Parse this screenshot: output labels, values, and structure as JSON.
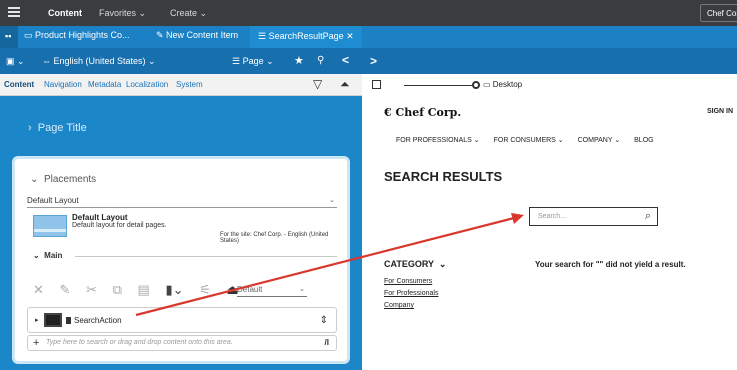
{
  "topbar": {
    "app_menu_icon": "hamburger-icon",
    "content_label": "Content",
    "favorites_label": "Favorites ⌄",
    "create_label": "Create ⌄",
    "user_label": "Chef Corp"
  },
  "tabs": [
    {
      "icon": "page-icon",
      "label": "Product Highlights Co..."
    },
    {
      "icon": "pencil-icon",
      "label": "New Content Item"
    },
    {
      "icon": "list-icon",
      "label": "SearchResultPage ✕"
    }
  ],
  "toolbar": {
    "site_label": "English (United States) ⌄",
    "page_label": "Page ⌄",
    "star_icon": "star-icon",
    "pin_icon": "pin-icon",
    "collapse_icon": "chevron-left-icon",
    "expand_icon": "chevron-right-icon"
  },
  "subtabs": [
    "Content",
    "Navigation",
    "Metadata",
    "Localization",
    "System"
  ],
  "left": {
    "page_title": "Page Title",
    "placements_label": "Placements",
    "layout_label": "Default Layout",
    "layout_title": "Default Layout",
    "layout_desc": "Default layout for detail pages.",
    "layout_site": "For the site: Chef Corp. - English (United States)",
    "main_label": "Main",
    "default_select": "Default",
    "action_label": "SearchAction",
    "add_placeholder": "Type here to search or drag and drop content onto this area."
  },
  "preview": {
    "device_label": "Desktop"
  },
  "site": {
    "logo": "Chef Corp.",
    "signin": "SIGN IN",
    "nav": [
      "FOR PROFESSIONALS ⌄",
      "FOR CONSUMERS ⌄",
      "COMPANY ⌄",
      "BLOG"
    ],
    "title": "SEARCH RESULTS",
    "search_placeholder": "Search...",
    "category_label": "CATEGORY",
    "category_links": [
      "For Consumers",
      "For Professionals",
      "Company"
    ],
    "no_result": "Your search for \"\" did not yield a result."
  },
  "colors": {
    "accent": "#1b86c8",
    "arrow": "#d9382e"
  }
}
